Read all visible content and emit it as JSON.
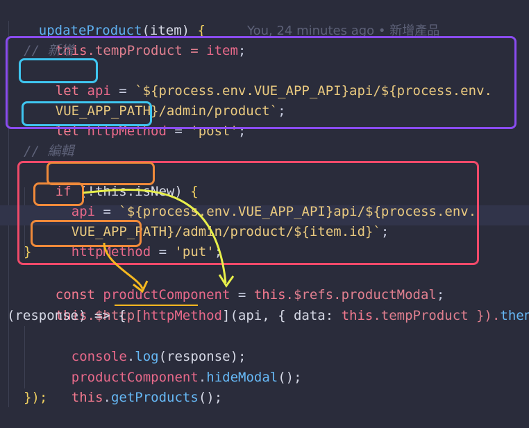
{
  "editor": {
    "blame": "You, 24 minutes ago • 新增產品",
    "lines": {
      "l0": {
        "name": "updateProduct",
        "open": "(item) ",
        "brace": "{"
      },
      "l1": {
        "this": "this",
        "rest": ".tempProduct = ",
        "item": "item",
        "end": ";"
      },
      "l2": "// 新增",
      "l3": {
        "kw": "let ",
        "var": "api",
        "eq": " = ",
        "str": "`${process.env.VUE_APP_API}api/${process.env."
      },
      "l4": {
        "str": "VUE_APP_PATH}/admin/product`",
        "end": ";"
      },
      "l5": {
        "kw": "let ",
        "var": "httpMethod",
        "eq": " = ",
        "str": "'post'",
        "end": ";"
      },
      "l7": "// 編輯",
      "l8": {
        "kw": "if ",
        "cond": "(!this.isNew)",
        "brace": " {"
      },
      "l9": {
        "var": "api",
        "eq": " = ",
        "str": "`${process.env.VUE_APP_API}api/${process.env."
      },
      "l10": {
        "str": "VUE_APP_PATH}/admin/product/${item.id}`",
        "end": ";"
      },
      "l11": {
        "var": "httpMethod",
        "eq": " = ",
        "str": "'put'",
        "end": ";"
      },
      "l12": "}",
      "l13": {
        "kw": "const ",
        "var": "productComponent",
        "eq": " = ",
        "this": "this",
        "rest": ".$refs.productModal",
        "end": ";"
      },
      "l14": {
        "this": "this",
        "rest": ".$http[",
        "var": "httpMethod",
        "rest2": "](api, { data: ",
        "this2": "this",
        "rest3": ".tempProduct }).",
        "then": "then("
      },
      "l15": {
        "p": "(response) => {"
      },
      "l16": {
        "obj": "console",
        "dot": ".",
        "m": "log",
        "args": "(response);"
      },
      "l17": {
        "obj": "productComponent",
        "dot": ".",
        "m": "hideModal",
        "args": "();"
      },
      "l18": {
        "this": "this",
        "dot": ".",
        "m": "getProducts",
        "args": "();"
      },
      "l19": "});"
    }
  },
  "colors": {
    "purple_box": "#8a4cf0",
    "cyan_box": "#3fc6f0",
    "red_box": "#f04a6a",
    "orange_box": "#f08a3a",
    "yellow_arrow": "#e8f04a",
    "orange_arrow": "#f5b820"
  }
}
